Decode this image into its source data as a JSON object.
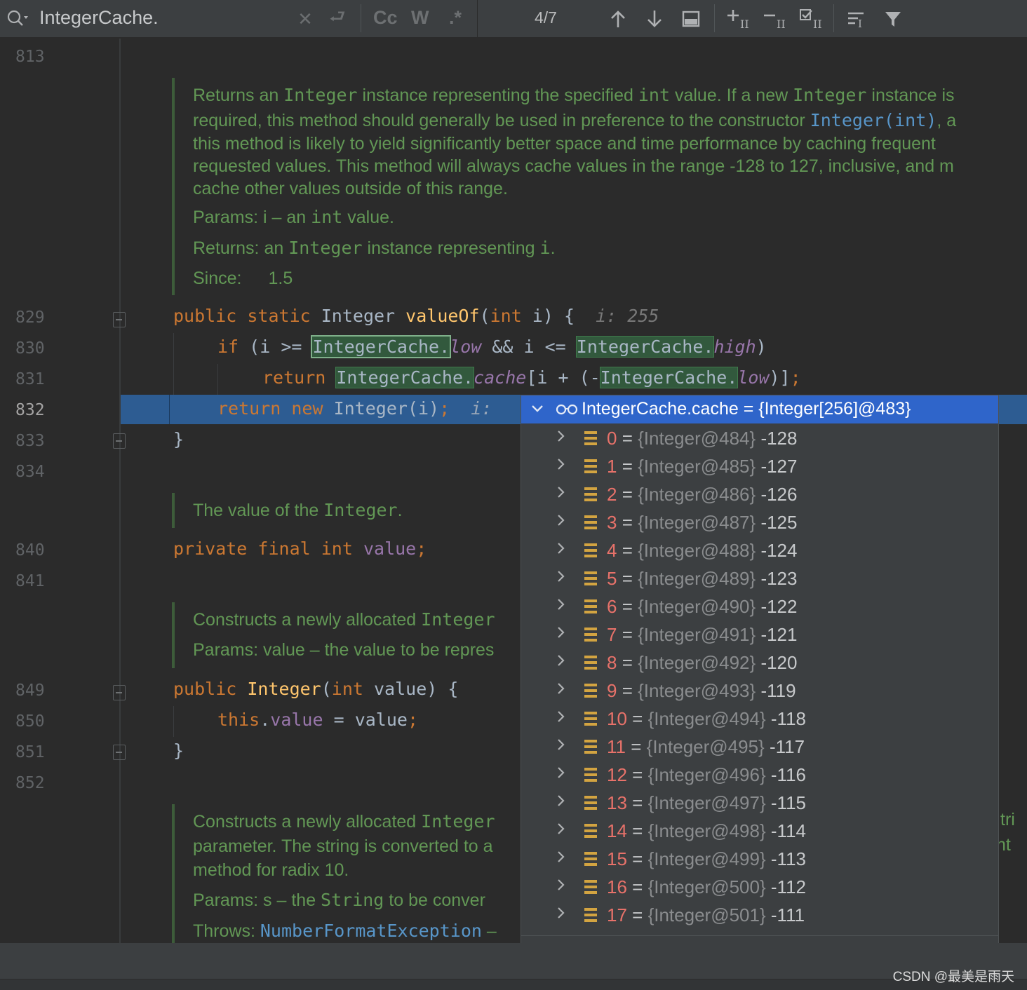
{
  "findbar": {
    "query": "IntegerCache.",
    "match_count": "4/7",
    "opt_case": "Cc",
    "opt_word": "W",
    "opt_regex": ".*"
  },
  "line_numbers": [
    "813",
    "829",
    "830",
    "831",
    "832",
    "833",
    "834",
    "840",
    "841",
    "849",
    "850",
    "851",
    "852"
  ],
  "doc1": {
    "lines": [
      [
        "Returns an ",
        "Integer",
        " instance representing the specified ",
        "int",
        " value. If a new ",
        "Integer",
        " instance is"
      ],
      [
        "required, this method should generally be used in preference to the constructor ",
        "Integer(int)",
        ", a"
      ],
      [
        "this method is likely to yield significantly better space and time performance by caching frequent"
      ],
      [
        "requested values. This method will always cache values in the range -128 to 127, inclusive, and m"
      ],
      [
        "cache other values outside of this range."
      ]
    ],
    "params_label": "Params:",
    "params_value": "i – an ",
    "params_code": "int",
    "params_tail": " value.",
    "returns_label": "Returns:",
    "returns_value": "an ",
    "returns_code": "Integer",
    "returns_tail": " instance representing ",
    "returns_code2": "i",
    "returns_end": ".",
    "since_label": "Since:",
    "since_value": "1.5"
  },
  "code": {
    "l829": {
      "kw1": "public",
      "kw2": "static",
      "type": "Integer",
      "fn": "valueOf",
      "open": "(",
      "kw3": "int",
      "rest": " i) {",
      "hint": "i: 255"
    },
    "l830": {
      "kw": "if",
      "p1": " (i >= ",
      "c1": "IntegerCache.",
      "f1": "low",
      "p2": " && i <= ",
      "c2": "IntegerCache.",
      "f2": "high",
      "p3": ")"
    },
    "l831": {
      "kw": "return",
      "c1": "IntegerCache.",
      "f1": "cache",
      "p1": "[i + (-",
      "c2": "IntegerCache.",
      "f2": "low",
      "p2": ")]",
      "semi": ";"
    },
    "l832": {
      "kw1": "return",
      "kw2": "new",
      "rest": " Integer(i)",
      "semi": ";",
      "hint": "i:"
    },
    "l833": "}",
    "l840": {
      "kw1": "private",
      "kw2": "final",
      "kw3": "int",
      "field": "value",
      "semi": ";"
    },
    "l849": {
      "kw1": "public",
      "fn": "Integer",
      "open": "(",
      "kw2": "int",
      "rest": " value) {"
    },
    "l850": {
      "kw": "this",
      "dot": ".",
      "field": "value",
      "rest": " = value",
      "semi": ";"
    },
    "l851": "}"
  },
  "doc2": {
    "pre": "The value of the ",
    "code": "Integer",
    "post": "."
  },
  "doc3": {
    "line1_pre": "Constructs a newly allocated ",
    "line1_code": "Integer",
    "params_label": "Params:",
    "params_value": "value – the value to be repres"
  },
  "doc4": {
    "line1_pre": "Constructs a newly allocated ",
    "line1_code": "Integer",
    "line1_right": "tri",
    "line2": "parameter. The string is converted to a",
    "line2_right": "nt",
    "line3": "method for radix 10.",
    "params_label": "Params:",
    "params_value": "s – the ",
    "params_code": "String",
    "params_tail": " to be conver",
    "throws_label": "Throws:",
    "throws_link": "NumberFormatException",
    "throws_tail": " –"
  },
  "popup": {
    "header": "IntegerCache.cache = {Integer[256]@483}",
    "rows": [
      {
        "idx": "0",
        "ref": "{Integer@484}",
        "val": "-128"
      },
      {
        "idx": "1",
        "ref": "{Integer@485}",
        "val": "-127"
      },
      {
        "idx": "2",
        "ref": "{Integer@486}",
        "val": "-126"
      },
      {
        "idx": "3",
        "ref": "{Integer@487}",
        "val": "-125"
      },
      {
        "idx": "4",
        "ref": "{Integer@488}",
        "val": "-124"
      },
      {
        "idx": "5",
        "ref": "{Integer@489}",
        "val": "-123"
      },
      {
        "idx": "6",
        "ref": "{Integer@490}",
        "val": "-122"
      },
      {
        "idx": "7",
        "ref": "{Integer@491}",
        "val": "-121"
      },
      {
        "idx": "8",
        "ref": "{Integer@492}",
        "val": "-120"
      },
      {
        "idx": "9",
        "ref": "{Integer@493}",
        "val": "-119"
      },
      {
        "idx": "10",
        "ref": "{Integer@494}",
        "val": "-118"
      },
      {
        "idx": "11",
        "ref": "{Integer@495}",
        "val": "-117"
      },
      {
        "idx": "12",
        "ref": "{Integer@496}",
        "val": "-116"
      },
      {
        "idx": "13",
        "ref": "{Integer@497}",
        "val": "-115"
      },
      {
        "idx": "14",
        "ref": "{Integer@498}",
        "val": "-114"
      },
      {
        "idx": "15",
        "ref": "{Integer@499}",
        "val": "-113"
      },
      {
        "idx": "16",
        "ref": "{Integer@500}",
        "val": "-112"
      },
      {
        "idx": "17",
        "ref": "{Integer@501}",
        "val": "-111"
      }
    ]
  },
  "watermark": "CSDN @最美是雨天",
  "icons": {
    "findbar": [
      "search-icon",
      "clear-icon",
      "newline-icon",
      "match-case-icon",
      "words-icon",
      "regex-icon",
      "previous-occurrence-icon",
      "next-occurrence-icon",
      "open-in-find-window-icon",
      "add-selection-icon",
      "remove-selection-icon",
      "select-all-occurrences-icon",
      "filter-settings-icon",
      "filter-icon"
    ],
    "popup": [
      "watch-glasses-icon",
      "expand-chevron-icon",
      "array-icon",
      "open-in-debugger-icon",
      "back-icon",
      "forward-icon"
    ]
  },
  "colors": {
    "keyword": "#cc7832",
    "method": "#ffc66d",
    "field": "#9876aa",
    "doc": "#629755",
    "execution_line": "#2d5c92",
    "popup_header": "#2f65ca",
    "array_index": "#e8726a"
  }
}
